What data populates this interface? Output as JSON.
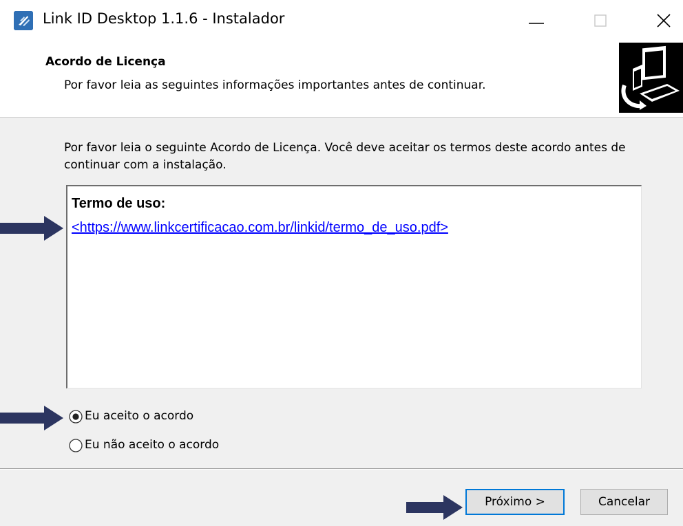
{
  "window": {
    "title": "Link ID Desktop 1.1.6 - Instalador"
  },
  "header": {
    "title": "Acordo de Licença",
    "subtitle": "Por favor leia as seguintes informações importantes antes de continuar."
  },
  "body": {
    "intro": "Por favor leia o seguinte Acordo de Licença. Você deve aceitar os termos deste acordo antes de continuar com a instalação.",
    "license": {
      "heading": "Termo de uso:",
      "link": "<https://www.linkcertificacao.com.br/linkid/termo_de_uso.pdf>"
    },
    "options": [
      {
        "label": "Eu aceito o acordo",
        "selected": true
      },
      {
        "label": "Eu não aceito o acordo",
        "selected": false
      }
    ]
  },
  "buttons": {
    "next": "Próximo >",
    "cancel": "Cancelar"
  },
  "icons": {
    "app": "installer-app-icon",
    "logo": "computer-setup-icon",
    "arrow": "pointer-arrow-icon"
  },
  "colors": {
    "arrow": "#2c3560",
    "link": "#0000ff",
    "focus_border": "#0078d7",
    "panel_bg": "#f0f0f0"
  }
}
